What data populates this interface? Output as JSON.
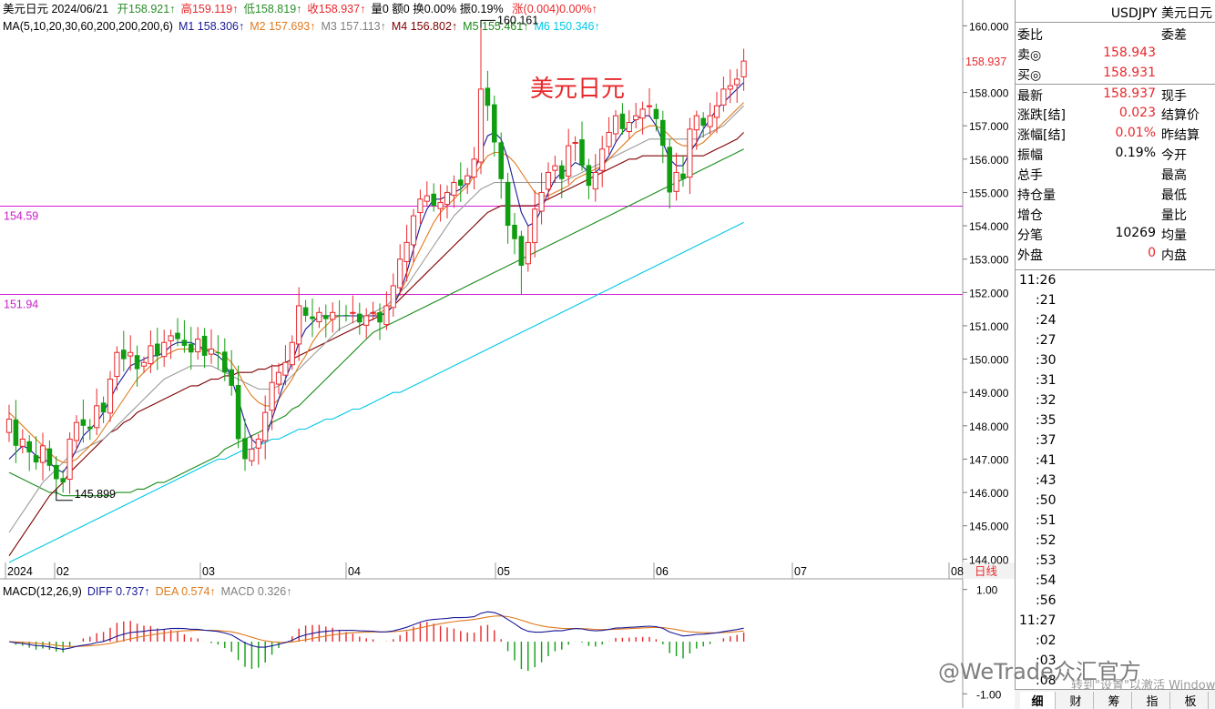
{
  "header": {
    "line1": [
      {
        "text": "美元日元 2024/06/21 ",
        "cls": ""
      },
      {
        "text": "开158.921↑",
        "cls": "g"
      },
      {
        "text": "高159.119↑",
        "cls": "r"
      },
      {
        "text": "低158.819↑",
        "cls": "g"
      },
      {
        "text": "收158.937↑",
        "cls": "r"
      },
      {
        "text": "量0 额0 换0.00% 振0.19% ",
        "cls": ""
      },
      {
        "text": "涨(0.004)0.00%↑",
        "cls": "r"
      }
    ],
    "line2": [
      {
        "text": "MA(5,10,20,30,60,200,200,200,6)",
        "color": "#000000"
      },
      {
        "text": "M1 158.306↑",
        "color": "#1a1a9a"
      },
      {
        "text": "M2 157.693↑",
        "color": "#e07a1e"
      },
      {
        "text": "M3 157.113↑",
        "color": "#808080"
      },
      {
        "text": "M4 156.802↑",
        "color": "#800000"
      },
      {
        "text": "M5 155.461↑",
        "color": "#1a8c1a"
      },
      {
        "text": "M6 150.346↑",
        "color": "#00c8e6"
      }
    ],
    "macd_line": [
      {
        "text": "MACD(12,26,9)",
        "color": "#000000"
      },
      {
        "text": "DIFF 0.737↑",
        "color": "#1a1a9a"
      },
      {
        "text": "DEA 0.574↑",
        "color": "#e07a1e"
      },
      {
        "text": "MACD 0.326↑",
        "color": "#808080"
      }
    ]
  },
  "chart_data": {
    "type": "candlestick",
    "title": "美元日元",
    "y_ticks": [
      "160.000",
      "159.000",
      "158.000",
      "157.000",
      "156.000",
      "155.000",
      "154.000",
      "153.000",
      "152.000",
      "151.000",
      "150.000",
      "149.000",
      "148.000",
      "147.000",
      "146.000",
      "145.000",
      "144.000"
    ],
    "ylim": [
      143.9,
      160.5
    ],
    "x_ticks": [
      "2024",
      "02",
      "03",
      "04",
      "05",
      "06",
      "07",
      "08"
    ],
    "period_label": "日线",
    "last_price": "158.937",
    "annotations": {
      "high": "160.161",
      "low": "145.899"
    },
    "hlines": [
      {
        "value": 154.59,
        "label": "154.59"
      },
      {
        "value": 151.94,
        "label": "151.94"
      }
    ],
    "macd_ticks": [
      "1.00",
      "-1.00"
    ],
    "closes": [
      148.2,
      147.4,
      147.6,
      147.2,
      146.9,
      147.4,
      146.8,
      146.4,
      146.3,
      147.6,
      148.1,
      148.0,
      147.9,
      148.6,
      148.4,
      149.4,
      150.2,
      150.0,
      150.2,
      149.7,
      149.9,
      150.4,
      150.1,
      150.5,
      150.7,
      150.6,
      150.4,
      150.2,
      150.6,
      150.1,
      150.3,
      150.2,
      149.6,
      149.2,
      147.6,
      147.0,
      147.3,
      147.6,
      148.4,
      149.3,
      149.6,
      149.9,
      150.5,
      151.6,
      151.3,
      151.2,
      151.4,
      151.2,
      151.4,
      151.3,
      151.3,
      151.4,
      151.1,
      151.3,
      151.4,
      151.1,
      151.6,
      152.2,
      153.0,
      153.5,
      154.3,
      154.8,
      154.9,
      154.6,
      154.7,
      155.0,
      155.3,
      155.2,
      155.5,
      156.0,
      158.1,
      157.6,
      156.5,
      155.4,
      154.0,
      153.6,
      152.8,
      153.5,
      154.5,
      155.0,
      155.6,
      155.8,
      155.4,
      156.4,
      156.5,
      155.8,
      155.2,
      155.6,
      156.3,
      156.8,
      157.3,
      156.9,
      157.1,
      157.3,
      157.5,
      157.6,
      157.2,
      156.4,
      155.0,
      155.6,
      155.4,
      156.9,
      157.3,
      157.0,
      157.3,
      157.6,
      158.1,
      158.2,
      158.4,
      158.94
    ],
    "ma5": [
      147.0,
      147.2,
      147.4,
      147.3,
      147.1,
      147.0,
      146.9,
      146.7,
      146.6,
      146.9,
      147.3,
      147.7,
      147.9,
      148.1,
      148.4,
      148.8,
      149.2,
      149.5,
      149.8,
      149.9,
      150.0,
      150.1,
      150.1,
      150.2,
      150.4,
      150.5,
      150.5,
      150.5,
      150.4,
      150.3,
      150.2,
      150.1,
      149.9,
      149.4,
      148.8,
      148.1,
      147.6,
      147.4,
      147.6,
      148.2,
      148.8,
      149.4,
      149.9,
      150.5,
      150.9,
      151.1,
      151.3,
      151.3,
      151.3,
      151.3,
      151.3,
      151.3,
      151.3,
      151.3,
      151.3,
      151.3,
      151.4,
      151.6,
      152.0,
      152.6,
      153.3,
      154.0,
      154.5,
      154.8,
      154.8,
      154.9,
      155.0,
      155.1,
      155.3,
      155.6,
      156.2,
      156.7,
      156.8,
      156.6,
      156.0,
      155.2,
      154.4,
      154.0,
      154.1,
      154.5,
      155.0,
      155.4,
      155.6,
      155.7,
      155.9,
      155.8,
      155.6,
      155.6,
      155.8,
      156.1,
      156.5,
      156.8,
      157.0,
      157.2,
      157.3,
      157.3,
      157.0,
      156.5,
      156.0,
      155.8,
      155.8,
      156.2,
      156.5,
      156.9,
      157.2,
      157.5,
      157.7,
      157.9,
      158.1,
      158.3
    ],
    "ma10": [
      148.4,
      148.2,
      148.0,
      147.8,
      147.6,
      147.4,
      147.2,
      147.0,
      146.9,
      146.9,
      147.0,
      147.2,
      147.4,
      147.6,
      147.9,
      148.2,
      148.5,
      148.8,
      149.1,
      149.4,
      149.6,
      149.8,
      150.0,
      150.1,
      150.2,
      150.3,
      150.3,
      150.3,
      150.3,
      150.3,
      150.3,
      150.2,
      150.1,
      149.9,
      149.6,
      149.2,
      148.9,
      148.7,
      148.6,
      148.6,
      148.8,
      149.1,
      149.4,
      149.8,
      150.1,
      150.5,
      150.8,
      151.0,
      151.2,
      151.3,
      151.3,
      151.3,
      151.3,
      151.3,
      151.3,
      151.4,
      151.5,
      151.7,
      152.0,
      152.4,
      152.9,
      153.3,
      153.7,
      154.1,
      154.4,
      154.6,
      154.8,
      155.0,
      155.2,
      155.5,
      155.8,
      156.1,
      156.2,
      156.2,
      156.1,
      155.9,
      155.6,
      155.3,
      155.0,
      154.9,
      154.9,
      155.0,
      155.1,
      155.2,
      155.4,
      155.5,
      155.6,
      155.7,
      155.8,
      156.0,
      156.2,
      156.4,
      156.6,
      156.8,
      156.9,
      157.0,
      157.0,
      156.9,
      156.7,
      156.5,
      156.4,
      156.4,
      156.4,
      156.5,
      156.7,
      156.9,
      157.1,
      157.3,
      157.5,
      157.7
    ],
    "ma20": [
      144.8,
      145.1,
      145.4,
      145.7,
      146.0,
      146.3,
      146.5,
      146.7,
      146.9,
      147.1,
      147.2,
      147.3,
      147.4,
      147.5,
      147.6,
      147.8,
      148.0,
      148.2,
      148.4,
      148.6,
      148.8,
      149.0,
      149.2,
      149.4,
      149.5,
      149.6,
      149.7,
      149.8,
      149.8,
      149.8,
      149.8,
      149.7,
      149.6,
      149.5,
      149.4,
      149.3,
      149.2,
      149.1,
      149.1,
      149.1,
      149.2,
      149.3,
      149.5,
      149.7,
      149.9,
      150.1,
      150.3,
      150.5,
      150.7,
      150.9,
      151.0,
      151.1,
      151.2,
      151.3,
      151.4,
      151.5,
      151.6,
      151.8,
      152.0,
      152.2,
      152.5,
      152.8,
      153.1,
      153.4,
      153.7,
      154.0,
      154.3,
      154.5,
      154.7,
      154.9,
      155.1,
      155.2,
      155.3,
      155.3,
      155.3,
      155.3,
      155.3,
      155.3,
      155.3,
      155.3,
      155.3,
      155.3,
      155.3,
      155.4,
      155.5,
      155.6,
      155.7,
      155.8,
      155.9,
      156.0,
      156.1,
      156.2,
      156.3,
      156.4,
      156.5,
      156.6,
      156.6,
      156.6,
      156.6,
      156.6,
      156.6,
      156.6,
      156.6,
      156.7,
      156.8,
      156.9,
      157.0,
      157.2,
      157.4,
      157.6
    ],
    "ma30": [
      144.1,
      144.4,
      144.7,
      145.0,
      145.3,
      145.6,
      145.9,
      146.1,
      146.3,
      146.6,
      146.8,
      147.0,
      147.2,
      147.4,
      147.6,
      147.8,
      147.9,
      148.1,
      148.2,
      148.4,
      148.5,
      148.6,
      148.7,
      148.8,
      148.9,
      149.0,
      149.1,
      149.2,
      149.2,
      149.3,
      149.4,
      149.4,
      149.5,
      149.5,
      149.6,
      149.6,
      149.6,
      149.7,
      149.7,
      149.8,
      149.8,
      149.9,
      150.0,
      150.1,
      150.2,
      150.3,
      150.4,
      150.5,
      150.6,
      150.7,
      150.8,
      150.9,
      151.0,
      151.1,
      151.2,
      151.3,
      151.4,
      151.6,
      151.8,
      152.0,
      152.2,
      152.4,
      152.6,
      152.8,
      153.0,
      153.2,
      153.4,
      153.6,
      153.8,
      154.0,
      154.2,
      154.4,
      154.5,
      154.6,
      154.6,
      154.6,
      154.6,
      154.6,
      154.6,
      154.7,
      154.8,
      154.9,
      155.0,
      155.1,
      155.2,
      155.3,
      155.4,
      155.5,
      155.6,
      155.7,
      155.8,
      155.9,
      156.0,
      156.0,
      156.1,
      156.1,
      156.1,
      156.1,
      156.1,
      156.1,
      156.1,
      156.1,
      156.1,
      156.1,
      156.2,
      156.3,
      156.4,
      156.5,
      156.6,
      156.8
    ],
    "ma60": [
      146.6,
      146.5,
      146.4,
      146.3,
      146.2,
      146.1,
      146.0,
      146.0,
      145.9,
      145.9,
      145.9,
      145.9,
      145.9,
      145.9,
      145.9,
      145.9,
      146.0,
      146.0,
      146.0,
      146.1,
      146.1,
      146.2,
      146.3,
      146.3,
      146.4,
      146.5,
      146.6,
      146.7,
      146.8,
      146.9,
      147.0,
      147.1,
      147.3,
      147.4,
      147.5,
      147.6,
      147.7,
      147.8,
      147.9,
      148.1,
      148.2,
      148.3,
      148.5,
      148.6,
      148.8,
      149.0,
      149.2,
      149.4,
      149.6,
      149.8,
      150.0,
      150.2,
      150.4,
      150.6,
      150.8,
      150.9,
      151.0,
      151.1,
      151.2,
      151.3,
      151.4,
      151.5,
      151.6,
      151.7,
      151.8,
      151.9,
      152.0,
      152.1,
      152.2,
      152.3,
      152.4,
      152.5,
      152.6,
      152.7,
      152.8,
      152.9,
      153.0,
      153.1,
      153.2,
      153.3,
      153.4,
      153.5,
      153.6,
      153.7,
      153.8,
      153.9,
      154.0,
      154.1,
      154.2,
      154.3,
      154.4,
      154.5,
      154.6,
      154.7,
      154.8,
      154.9,
      155.0,
      155.1,
      155.2,
      155.3,
      155.4,
      155.5,
      155.6,
      155.7,
      155.8,
      155.9,
      156.0,
      156.1,
      156.2,
      156.3
    ],
    "ma200": [
      143.9,
      144.0,
      144.1,
      144.2,
      144.3,
      144.4,
      144.5,
      144.6,
      144.7,
      144.8,
      144.9,
      145.0,
      145.1,
      145.2,
      145.3,
      145.4,
      145.5,
      145.6,
      145.7,
      145.8,
      145.9,
      146.0,
      146.1,
      146.2,
      146.3,
      146.4,
      146.5,
      146.6,
      146.7,
      146.8,
      146.9,
      147.0,
      147.0,
      147.1,
      147.2,
      147.3,
      147.3,
      147.4,
      147.5,
      147.6,
      147.6,
      147.7,
      147.8,
      147.9,
      147.9,
      148.0,
      148.1,
      148.2,
      148.2,
      148.3,
      148.4,
      148.5,
      148.5,
      148.6,
      148.7,
      148.8,
      148.9,
      149.0,
      149.0,
      149.1,
      149.2,
      149.3,
      149.4,
      149.5,
      149.6,
      149.7,
      149.8,
      149.9,
      150.0,
      150.1,
      150.2,
      150.3,
      150.4,
      150.5,
      150.6,
      150.7,
      150.8,
      150.9,
      151.0,
      151.1,
      151.2,
      151.3,
      151.4,
      151.5,
      151.6,
      151.7,
      151.8,
      151.9,
      152.0,
      152.1,
      152.2,
      152.3,
      152.4,
      152.5,
      152.6,
      152.7,
      152.8,
      152.9,
      153.0,
      153.1,
      153.2,
      153.3,
      153.4,
      153.5,
      153.6,
      153.7,
      153.8,
      153.9,
      154.0,
      154.1
    ]
  },
  "watermark": {
    "text": "@WeTrade众汇官方",
    "activate": "转到\"设置\"以激活 Windows。"
  },
  "quote": {
    "title": "USDJPY 美元日元",
    "rows": [
      {
        "l": "委比",
        "v": "",
        "r": "委差",
        "vc": "#e8282c"
      },
      {
        "l": "卖◎",
        "v": "158.943",
        "r": "",
        "vc": "#e8282c"
      },
      {
        "l": "买◎",
        "v": "158.931",
        "r": "",
        "vc": "#e8282c"
      },
      {
        "l": "最新",
        "v": "158.937",
        "r": "现手",
        "vc": "#e8282c"
      },
      {
        "l": "涨跌[结]",
        "v": "0.023",
        "r": "结算价",
        "vc": "#e8282c"
      },
      {
        "l": "涨幅[结]",
        "v": "0.01%",
        "r": "昨结算",
        "vc": "#e8282c"
      },
      {
        "l": "振幅",
        "v": "0.19%",
        "r": "今开",
        "vc": "#000000"
      },
      {
        "l": "总手",
        "v": "",
        "r": "最高",
        "vc": "#000000"
      },
      {
        "l": "持仓量",
        "v": "",
        "r": "最低",
        "vc": "#000000"
      },
      {
        "l": "增仓",
        "v": "",
        "r": "量比",
        "vc": "#000000"
      },
      {
        "l": "分笔",
        "v": "10269",
        "r": "均量",
        "vc": "#000000"
      },
      {
        "l": "外盘",
        "v": "0",
        "r": "内盘",
        "vc": "#e8282c"
      }
    ],
    "ticks": [
      "11:26",
      ":21",
      ":24",
      ":27",
      ":30",
      ":31",
      ":32",
      ":35",
      ":37",
      ":41",
      ":43",
      ":50",
      ":51",
      ":52",
      ":53",
      ":54",
      ":56",
      "11:27",
      ":02",
      ":03",
      ":08"
    ],
    "tabs": [
      "细",
      "财",
      "筹",
      "指",
      "板"
    ]
  }
}
